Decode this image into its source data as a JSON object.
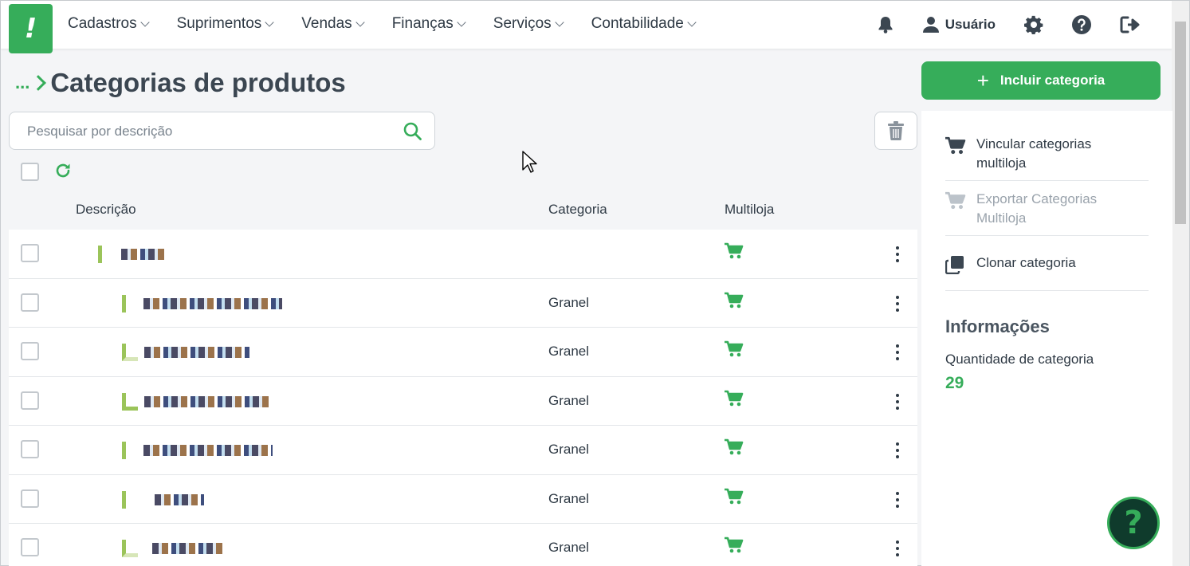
{
  "app": {
    "logo_text": "!",
    "menu": [
      {
        "label": "Cadastros"
      },
      {
        "label": "Suprimentos"
      },
      {
        "label": "Vendas"
      },
      {
        "label": "Finanças"
      },
      {
        "label": "Serviços"
      },
      {
        "label": "Contabilidade"
      }
    ],
    "user_label": "Usuário"
  },
  "page": {
    "breadcrumb_ellipsis": "...",
    "title": "Categorias de produtos",
    "add_button_label": "Incluir categoria",
    "add_button_icon": "+"
  },
  "search": {
    "placeholder": "Pesquisar por descrição",
    "value": ""
  },
  "table": {
    "headers": {
      "description": "Descrição",
      "category": "Categoria",
      "multistore": "Multiloja"
    },
    "rows": [
      {
        "category": "",
        "level": "parent",
        "multistore_icon": "cart-icon"
      },
      {
        "category": "Granel",
        "level": "child",
        "multistore_icon": "cart-icon"
      },
      {
        "category": "Granel",
        "level": "grandchild",
        "multistore_icon": "cart-icon"
      },
      {
        "category": "Granel",
        "level": "grandchild",
        "multistore_icon": "cart-icon"
      },
      {
        "category": "Granel",
        "level": "child",
        "multistore_icon": "cart-icon"
      },
      {
        "category": "Granel",
        "level": "child",
        "multistore_icon": "cart-icon"
      },
      {
        "category": "Granel",
        "level": "grandchild",
        "multistore_icon": "cart-icon"
      }
    ]
  },
  "panel": {
    "actions": [
      {
        "label": "Vincular categorias multiloja",
        "icon": "cart-icon",
        "disabled": false
      },
      {
        "label": "Exportar Categorias Multiloja",
        "icon": "cart-icon",
        "disabled": true
      },
      {
        "label": "Clonar categoria",
        "icon": "clone-icon",
        "disabled": false
      }
    ],
    "info_title": "Informações",
    "info_label": "Quantidade de categoria",
    "info_value": "29"
  },
  "help_fab_label": "?",
  "colors": {
    "brand_green": "#36ad5a",
    "text_dark": "#2f3a45",
    "background": "#f4f5f7",
    "tree_line": "#9bc45a"
  }
}
